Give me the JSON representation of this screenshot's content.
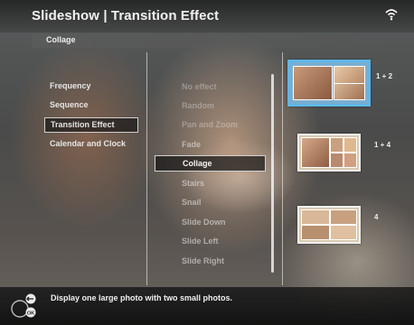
{
  "header": {
    "title": "Slideshow | Transition Effect",
    "subtitle": "Collage"
  },
  "left_menu": {
    "items": [
      {
        "label": "Frequency"
      },
      {
        "label": "Sequence"
      },
      {
        "label": "Transition Effect",
        "selected": true
      },
      {
        "label": "Calendar and Clock"
      }
    ]
  },
  "effects_menu": {
    "items": [
      {
        "label": "No effect"
      },
      {
        "label": "Random"
      },
      {
        "label": "Pan and Zoom"
      },
      {
        "label": "Fade"
      },
      {
        "label": "Collage",
        "selected": true
      },
      {
        "label": "Stairs"
      },
      {
        "label": "Snail"
      },
      {
        "label": "Slide Down"
      },
      {
        "label": "Slide Left"
      },
      {
        "label": "Slide Right"
      }
    ]
  },
  "previews": [
    {
      "label": "1 + 2",
      "selected": true
    },
    {
      "label": "1 + 4"
    },
    {
      "label": "4"
    }
  ],
  "footer": {
    "description": "Display one large photo with two small photos."
  },
  "colors": {
    "selection_border": "#d0d0d0",
    "preview_selected_border": "#5fb7e8"
  },
  "icons": [
    "wifi-icon",
    "back-icon",
    "ok-icon",
    "nav-ring-icon"
  ]
}
